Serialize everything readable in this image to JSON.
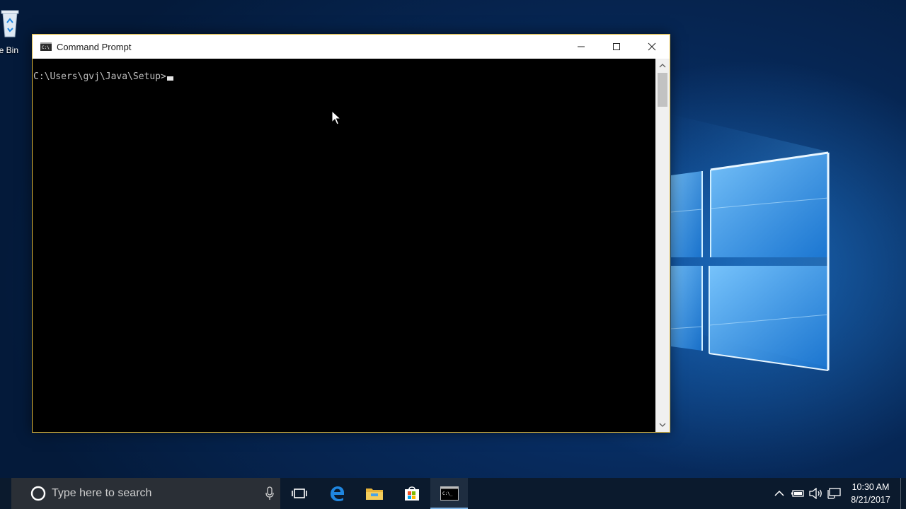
{
  "desktop": {
    "recycle_bin_label": "cle Bin"
  },
  "window": {
    "title": "Command Prompt",
    "console_prompt": "C:\\Users\\gvj\\Java\\Setup>",
    "border_color": "#e0b93c"
  },
  "taskbar": {
    "search_placeholder": "Type here to search",
    "pinned": [
      "task-view-icon",
      "edge-icon",
      "file-explorer-icon",
      "store-icon",
      "command-prompt-icon"
    ],
    "active_app": "command-prompt",
    "tray": {
      "time": "10:30 AM",
      "date": "8/21/2017"
    }
  },
  "colors": {
    "accent": "#1f86e0",
    "taskbar": "#0b1a2d"
  }
}
